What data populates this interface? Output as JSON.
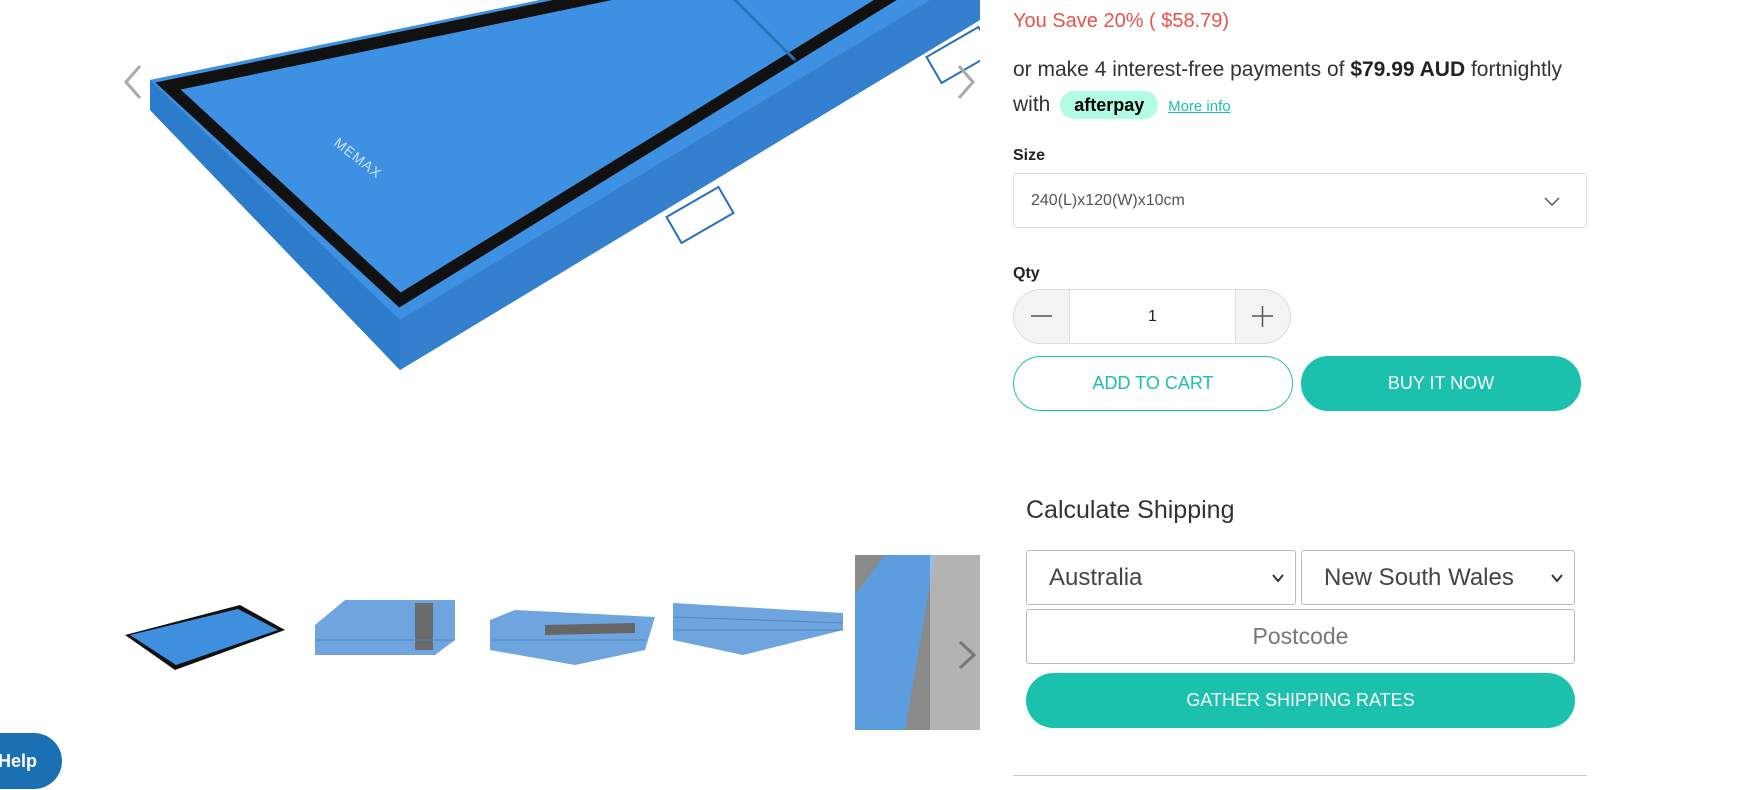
{
  "gallery": {
    "brand_mark": "MEMAX",
    "thumbnails": [
      "Blue folding mat top view",
      "Folded mat side",
      "Folded mat angle",
      "Folded mat closeup",
      "Mat detail"
    ]
  },
  "product": {
    "savings": "You Save 20% ( $58.79)",
    "afterpay": {
      "prefix": "or make 4 interest-free payments of",
      "amount": "$79.99 AUD",
      "suffix": "fortnightly",
      "with": "with",
      "badge": "afterpay",
      "more_info": "More info"
    },
    "size_label": "Size",
    "size_value": "240(L)x120(W)x10cm",
    "qty_label": "Qty",
    "qty_value": "1",
    "add_to_cart": "ADD TO CART",
    "buy_now": "BUY IT NOW"
  },
  "shipping": {
    "title": "Calculate Shipping",
    "country": "Australia",
    "state": "New South Wales",
    "postcode_placeholder": "Postcode",
    "gather_button": "GATHER SHIPPING RATES"
  },
  "help_button": "Help",
  "colors": {
    "accent": "#1bc1ad",
    "sale_red": "#e8534f",
    "mat_blue": "#3b8ee0",
    "help_blue": "#1b6fb3"
  }
}
